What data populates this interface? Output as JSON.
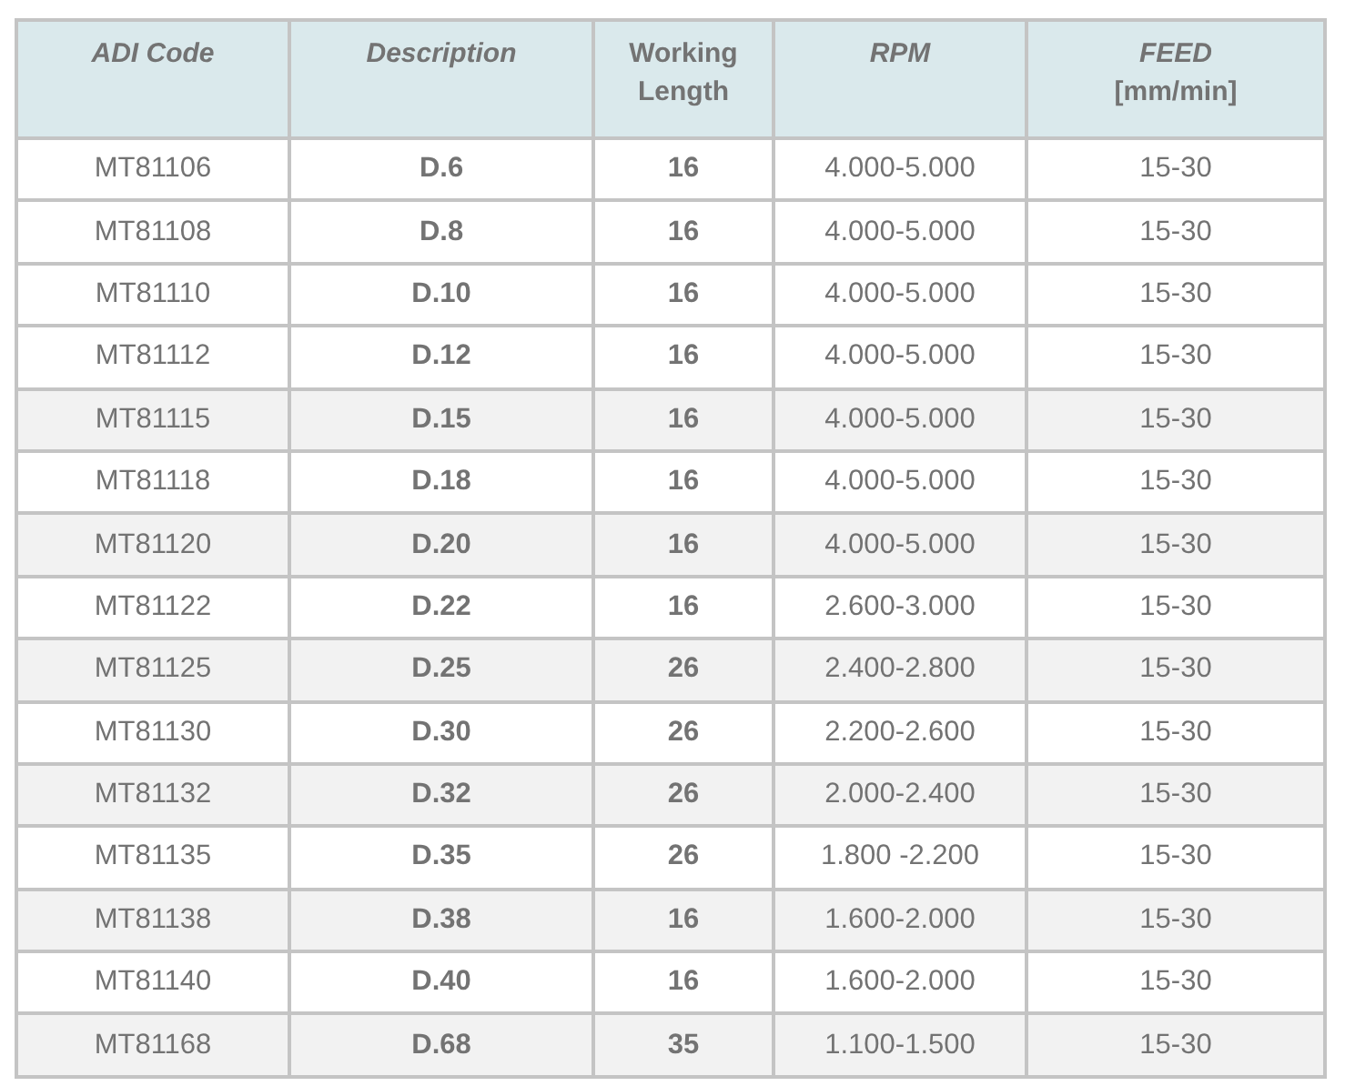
{
  "table": {
    "columns": [
      {
        "lines": [
          {
            "text": "ADI Code",
            "italic": true
          }
        ],
        "bold_cells": false
      },
      {
        "lines": [
          {
            "text": "Description",
            "italic": true
          }
        ],
        "bold_cells": true
      },
      {
        "lines": [
          {
            "text": "Working",
            "italic": false
          },
          {
            "text": "Length",
            "italic": false
          }
        ],
        "bold_cells": true
      },
      {
        "lines": [
          {
            "text": "RPM",
            "italic": true
          }
        ],
        "bold_cells": false
      },
      {
        "lines": [
          {
            "text": "FEED",
            "italic": true
          },
          {
            "text": "[mm/min]",
            "italic": false
          }
        ],
        "bold_cells": false
      }
    ],
    "rows": [
      {
        "shaded": false,
        "cells": [
          "MT81106",
          "D.6",
          "16",
          "4.000-5.000",
          "15-30"
        ]
      },
      {
        "shaded": false,
        "cells": [
          "MT81108",
          "D.8",
          "16",
          "4.000-5.000",
          "15-30"
        ]
      },
      {
        "shaded": false,
        "cells": [
          "MT81110",
          "D.10",
          "16",
          "4.000-5.000",
          "15-30"
        ]
      },
      {
        "shaded": false,
        "cells": [
          "MT81112",
          "D.12",
          "16",
          "4.000-5.000",
          "15-30"
        ]
      },
      {
        "shaded": true,
        "cells": [
          "MT81115",
          "D.15",
          "16",
          "4.000-5.000",
          "15-30"
        ]
      },
      {
        "shaded": false,
        "cells": [
          "MT81118",
          "D.18",
          "16",
          "4.000-5.000",
          "15-30"
        ]
      },
      {
        "shaded": true,
        "cells": [
          "MT81120",
          "D.20",
          "16",
          "4.000-5.000",
          "15-30"
        ]
      },
      {
        "shaded": false,
        "cells": [
          "MT81122",
          "D.22",
          "16",
          "2.600-3.000",
          "15-30"
        ]
      },
      {
        "shaded": true,
        "cells": [
          "MT81125",
          "D.25",
          "26",
          "2.400-2.800",
          "15-30"
        ]
      },
      {
        "shaded": false,
        "cells": [
          "MT81130",
          "D.30",
          "26",
          "2.200-2.600",
          "15-30"
        ]
      },
      {
        "shaded": true,
        "cells": [
          "MT81132",
          "D.32",
          "26",
          "2.000-2.400",
          "15-30"
        ]
      },
      {
        "shaded": false,
        "cells": [
          "MT81135",
          "D.35",
          "26",
          "1.800 -2.200",
          "15-30"
        ]
      },
      {
        "shaded": true,
        "cells": [
          "MT81138",
          "D.38",
          "16",
          "1.600-2.000",
          "15-30"
        ]
      },
      {
        "shaded": false,
        "cells": [
          "MT81140",
          "D.40",
          "16",
          "1.600-2.000",
          "15-30"
        ]
      },
      {
        "shaded": true,
        "cells": [
          "MT81168",
          "D.68",
          "35",
          "1.100-1.500",
          "15-30"
        ]
      }
    ]
  }
}
